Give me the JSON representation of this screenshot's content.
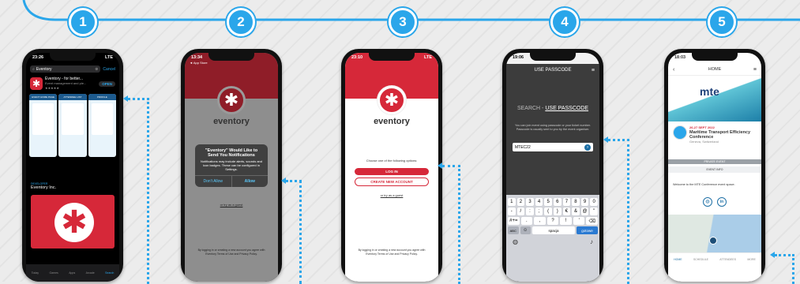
{
  "steps": [
    "1",
    "2",
    "3",
    "4",
    "5"
  ],
  "p1": {
    "time": "23:26",
    "status": "LTE",
    "search_value": "Eventory",
    "cancel": "Cancel",
    "app_name": "Eventory - for better...",
    "app_sub": "Event management and ple...",
    "rating": "★★★★★",
    "open": "OPEN",
    "shots": [
      "EVENT HOME PAGE",
      "ATTENDEE LIST",
      "PROFILE"
    ],
    "dev_small": "DEVELOPER",
    "dev": "Eventory Inc.",
    "tabs": [
      "Today",
      "Games",
      "Apps",
      "Arcade",
      "Search"
    ]
  },
  "p2": {
    "time": "13:34",
    "back": "◄ App Store",
    "brand": "eventory",
    "alert_title": "\"Eventory\" Would Like to Send You Notifications",
    "alert_body": "Notifications may include alerts, sounds and icon badges. These can be configured in Settings.",
    "dont": "Don't Allow",
    "allow": "Allow",
    "guest": "or try as a guest",
    "legal": "By logging in or creating a new account you agree with Eventory Terms of Use and Privacy Policy."
  },
  "p3": {
    "time": "23:10",
    "status": "LTE",
    "brand": "eventory",
    "choose": "Choose one of the following options:",
    "login": "LOG IN",
    "create": "CREATE NEW ACCOUNT",
    "guest": "or try as a guest",
    "legal": "By logging in or creating a new account you agree with Eventory Terms of Use and Privacy Policy."
  },
  "p4": {
    "time": "19:06",
    "title": "USE PASSCODE",
    "search_label": "SEARCH - ",
    "passcode_label": "USE PASSCODE",
    "desc": "You can join event using passcode or your ticket number. Passcode is usually sent to you by the event organiser.",
    "code": "MTEC22",
    "row1": [
      "1",
      "2",
      "3",
      "4",
      "5",
      "6",
      "7",
      "8",
      "9",
      "0"
    ],
    "row2": [
      "-",
      "/",
      ":",
      ";",
      "(",
      ")",
      "€",
      "&",
      "@",
      "\""
    ],
    "row3": [
      "#+=",
      ".",
      ",",
      "?",
      "!",
      "'",
      "⌫"
    ],
    "abc": "ABC",
    "space": "spacja",
    "go": "gotowe"
  },
  "p5": {
    "time": "18:03",
    "title": "HOME",
    "logo": "mte",
    "dates": "26-27 SEPT 2022",
    "event": "Maritime Transport Efficiency Conference",
    "place": "Geneva, Switzerland",
    "private": "PRIVATE EVENT",
    "info": "EVENT INFO",
    "welcome": "Welcome to the MTE Conference event space.",
    "nav": [
      "HOME",
      "SCHEDULE",
      "ATTENDEES",
      "MORE"
    ]
  },
  "colors": {
    "accent": "#2aa6ea",
    "brand": "#d62839"
  }
}
